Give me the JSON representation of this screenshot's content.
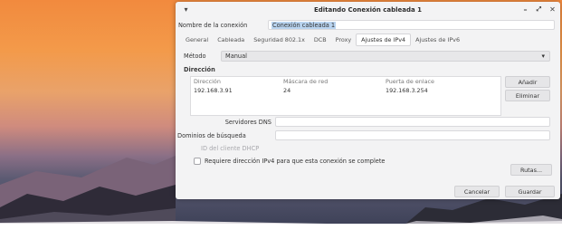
{
  "window": {
    "title": "Editando Conexión cableada 1",
    "menu_icon": "chevron-down-icon",
    "minimize_icon": "minimize-icon",
    "maximize_icon": "maximize-icon",
    "close_icon": "close-icon"
  },
  "connection": {
    "name_label": "Nombre de la conexión",
    "name_value": "Conexión cableada 1"
  },
  "tabs": [
    "General",
    "Cableada",
    "Seguridad 802.1x",
    "DCB",
    "Proxy",
    "Ajustes de IPv4",
    "Ajustes de IPv6"
  ],
  "active_tab": "Ajustes de IPv4",
  "ipv4": {
    "method_label": "Método",
    "method_value": "Manual",
    "section_title": "Dirección",
    "columns": [
      "Dirección",
      "Máscara de red",
      "Puerta de enlace"
    ],
    "rows": [
      {
        "address": "192.168.3.91",
        "netmask": "24",
        "gateway": "192.168.3.254"
      }
    ],
    "add_label": "Añadir",
    "remove_label": "Eliminar",
    "dns_label": "Servidores DNS",
    "dns_value": "",
    "search_label": "Dominios de búsqueda",
    "search_value": "",
    "dhcp_label": "ID del cliente DHCP",
    "require_label": "Requiere dirección IPv4 para que esta conexión se complete",
    "routes_label": "Rutas..."
  },
  "footer": {
    "cancel_label": "Cancelar",
    "save_label": "Guardar"
  }
}
